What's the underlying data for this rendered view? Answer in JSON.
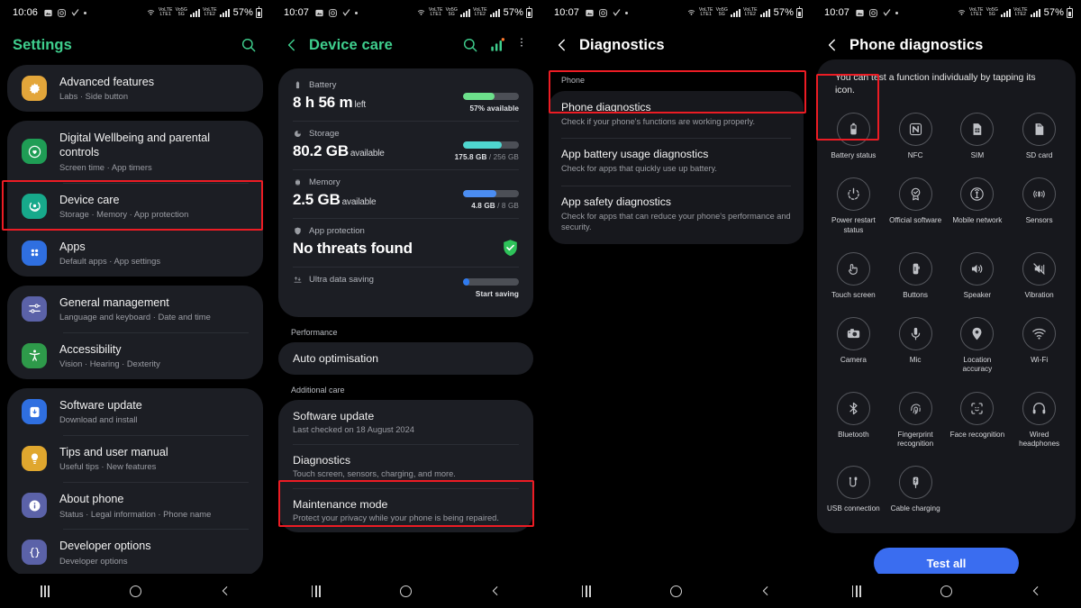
{
  "panels": [
    {
      "id": "settings",
      "statusbar": {
        "time": "10:06",
        "battery": "57%",
        "icons": [
          "photos-icon",
          "instagram-icon",
          "check-icon",
          "dot-icon"
        ],
        "right_icons": [
          "nfc-icon",
          "lte1-icon",
          "vo5g-icon",
          "signal-icon",
          "lte2-icon",
          "signal-icon",
          "battery-icon"
        ]
      },
      "appbar": {
        "title": "Settings",
        "title_color": "#3fcf8e",
        "right_icons": [
          "search-icon"
        ]
      },
      "groups": [
        {
          "items": [
            {
              "title": "Advanced features",
              "sub": "Labs  ·  Side button",
              "icon": "advanced-features-icon",
              "color": "#e3a63a",
              "highlight": false
            }
          ]
        },
        {
          "items": [
            {
              "title": "Digital Wellbeing and parental controls",
              "sub": "Screen time  ·  App timers",
              "icon": "wellbeing-icon",
              "color": "#1f9d55",
              "highlight": false
            },
            {
              "title": "Device care",
              "sub": "Storage  ·  Memory  ·  App protection",
              "icon": "device-care-icon",
              "color": "#17a98b",
              "highlight": true
            },
            {
              "title": "Apps",
              "sub": "Default apps  ·  App settings",
              "icon": "apps-icon",
              "color": "#2f6fe0",
              "highlight": false
            }
          ]
        },
        {
          "items": [
            {
              "title": "General management",
              "sub": "Language and keyboard  ·  Date and time",
              "icon": "sliders-icon",
              "color": "#5b62a8",
              "highlight": false
            },
            {
              "title": "Accessibility",
              "sub": "Vision  ·  Hearing  ·  Dexterity",
              "icon": "accessibility-icon",
              "color": "#2e9a4a",
              "highlight": false
            }
          ]
        },
        {
          "items": [
            {
              "title": "Software update",
              "sub": "Download and install",
              "icon": "software-update-icon",
              "color": "#2f6fe0",
              "highlight": false
            },
            {
              "title": "Tips and user manual",
              "sub": "Useful tips  ·  New features",
              "icon": "bulb-icon",
              "color": "#e0a72e",
              "highlight": false
            },
            {
              "title": "About phone",
              "sub": "Status  ·  Legal information  ·  Phone name",
              "icon": "info-icon",
              "color": "#5b62a8",
              "highlight": false
            },
            {
              "title": "Developer options",
              "sub": "Developer options",
              "icon": "braces-icon",
              "color": "#5b62a8",
              "highlight": false
            }
          ]
        }
      ]
    },
    {
      "id": "device-care",
      "statusbar": {
        "time": "10:07",
        "battery": "57%"
      },
      "appbar": {
        "title": "Device care",
        "title_color": "#3fcf8e",
        "back": "back-icon",
        "right_icons": [
          "search-icon",
          "usage-chart-icon",
          "more-options-icon"
        ]
      },
      "status_items": [
        {
          "label": "Battery",
          "icon": "battery-icon",
          "value": "8 h 56 m",
          "unit": "left",
          "bar_pct": 57,
          "bar_color": "#6ce08b",
          "caption": "57% available",
          "caption_dim": ""
        },
        {
          "label": "Storage",
          "icon": "storage-pie-icon",
          "value": "80.2 GB",
          "unit": "available",
          "bar_pct": 69,
          "bar_color": "#4fd6cf",
          "caption": "175.8 GB",
          "caption_dim": " / 256 GB"
        },
        {
          "label": "Memory",
          "icon": "memory-chip-icon",
          "value": "2.5 GB",
          "unit": "available",
          "bar_pct": 60,
          "bar_color": "#4b8df2",
          "caption": "4.8 GB",
          "caption_dim": " / 8 GB"
        },
        {
          "label": "App protection",
          "icon": "shield-icon",
          "value": "No threats found",
          "unit": "",
          "badge": "shield-check-icon"
        },
        {
          "label": "Ultra data saving",
          "icon": "data-saving-icon",
          "value": "",
          "unit": "",
          "bar_pct": 12,
          "bar_color": "#2f7bf0",
          "caption": "Start saving",
          "caption_dim": ""
        }
      ],
      "sections": [
        {
          "label": "Performance",
          "rows": [
            {
              "title": "Auto optimisation",
              "sub": "",
              "highlight": false
            }
          ]
        },
        {
          "label": "Additional care",
          "rows": [
            {
              "title": "Software update",
              "sub": "Last checked on 18 August 2024",
              "highlight": false
            },
            {
              "title": "Diagnostics",
              "sub": "Touch screen, sensors, charging, and more.",
              "highlight": true
            },
            {
              "title": "Maintenance mode",
              "sub": "Protect your privacy while your phone is being repaired.",
              "highlight": false
            }
          ]
        }
      ]
    },
    {
      "id": "diagnostics",
      "statusbar": {
        "time": "10:07",
        "battery": "57%"
      },
      "appbar": {
        "title": "Diagnostics",
        "title_color": "#ffffff",
        "back": "back-icon"
      },
      "section_label": "Phone",
      "rows": [
        {
          "title": "Phone diagnostics",
          "sub": "Check if your phone's functions are working properly.",
          "highlight": true
        },
        {
          "title": "App battery usage diagnostics",
          "sub": "Check for apps that quickly use up battery.",
          "highlight": false
        },
        {
          "title": "App safety diagnostics",
          "sub": "Check for apps that can reduce your phone's performance and security.",
          "highlight": false
        }
      ]
    },
    {
      "id": "phone-diagnostics",
      "statusbar": {
        "time": "10:07",
        "battery": "57%"
      },
      "appbar": {
        "title": "Phone diagnostics",
        "title_color": "#ffffff",
        "back": "back-icon"
      },
      "note": "You can test a function individually by tapping its icon.",
      "tests": [
        {
          "label": "Battery status",
          "icon": "battery-status-icon",
          "highlight": true
        },
        {
          "label": "NFC",
          "icon": "nfc-icon",
          "highlight": false
        },
        {
          "label": "SIM",
          "icon": "sim-card-icon",
          "highlight": false
        },
        {
          "label": "SD card",
          "icon": "sd-card-icon",
          "highlight": false
        },
        {
          "label": "Power restart status",
          "icon": "power-restart-icon",
          "highlight": false
        },
        {
          "label": "Official software",
          "icon": "official-software-icon",
          "highlight": false
        },
        {
          "label": "Mobile network",
          "icon": "mobile-network-icon",
          "highlight": false
        },
        {
          "label": "Sensors",
          "icon": "sensors-icon",
          "highlight": false
        },
        {
          "label": "Touch screen",
          "icon": "touch-screen-icon",
          "highlight": false
        },
        {
          "label": "Buttons",
          "icon": "buttons-icon",
          "highlight": false
        },
        {
          "label": "Speaker",
          "icon": "speaker-icon",
          "highlight": false
        },
        {
          "label": "Vibration",
          "icon": "vibration-icon",
          "highlight": false
        },
        {
          "label": "Camera",
          "icon": "camera-icon",
          "highlight": false
        },
        {
          "label": "Mic",
          "icon": "mic-icon",
          "highlight": false
        },
        {
          "label": "Location accuracy",
          "icon": "location-pin-icon",
          "highlight": false
        },
        {
          "label": "Wi-Fi",
          "icon": "wifi-icon",
          "highlight": false
        },
        {
          "label": "Bluetooth",
          "icon": "bluetooth-icon",
          "highlight": false
        },
        {
          "label": "Fingerprint recognition",
          "icon": "fingerprint-icon",
          "highlight": false
        },
        {
          "label": "Face recognition",
          "icon": "face-recognition-icon",
          "highlight": false
        },
        {
          "label": "Wired headphones",
          "icon": "headphones-icon",
          "highlight": false
        },
        {
          "label": "USB connection",
          "icon": "usb-icon",
          "highlight": false
        },
        {
          "label": "Cable charging",
          "icon": "cable-charging-icon",
          "highlight": false
        }
      ],
      "test_all_label": "Test all",
      "test_all_color": "#3a6df0"
    }
  ],
  "navbar": {
    "recent": "recents-icon",
    "home": "home-icon",
    "back": "back-icon"
  },
  "highlight_color": "#ec1c24"
}
